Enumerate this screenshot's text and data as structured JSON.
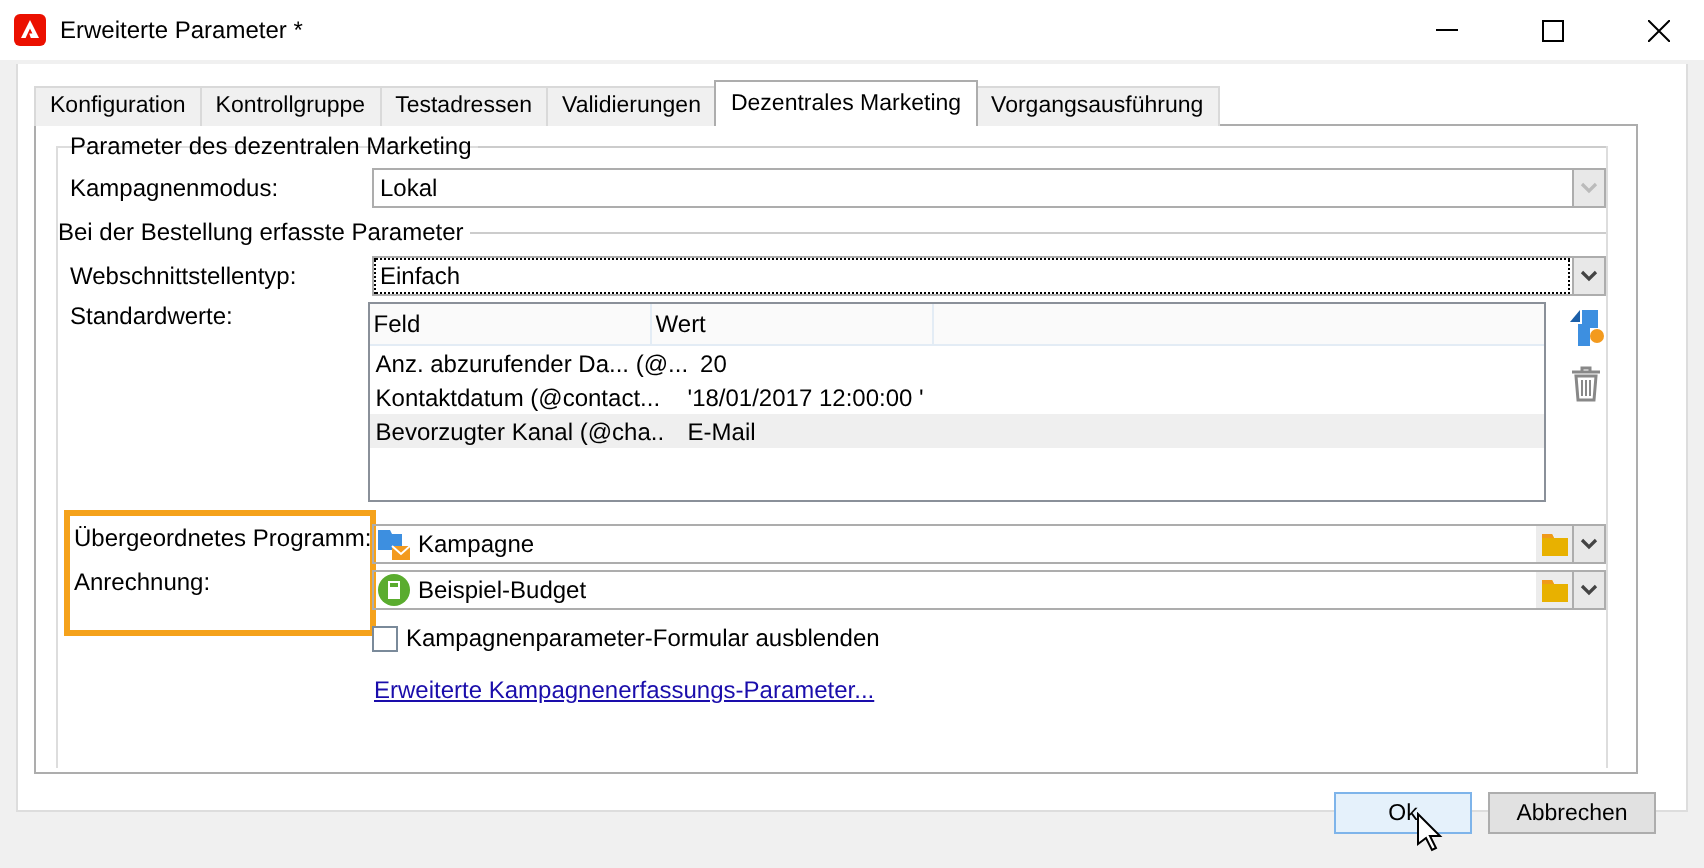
{
  "window": {
    "title": "Erweiterte Parameter *"
  },
  "tabs": [
    {
      "label": "Konfiguration",
      "selected": false
    },
    {
      "label": "Kontrollgruppe",
      "selected": false
    },
    {
      "label": "Testadressen",
      "selected": false
    },
    {
      "label": "Validierungen",
      "selected": false
    },
    {
      "label": "Dezentrales Marketing",
      "selected": true
    },
    {
      "label": "Vorgangsausführung",
      "selected": false
    }
  ],
  "group": {
    "title": "Parameter des dezentralen Marketing"
  },
  "campaign_mode": {
    "label": "Kampagnenmodus:",
    "value": "Lokal",
    "disabled": true
  },
  "section": {
    "title": "Bei der Bestellung erfasste Parameter"
  },
  "interface_type": {
    "label": "Webschnittstellentyp:",
    "value": "Einfach",
    "disabled": false
  },
  "defaults": {
    "label": "Standardwerte:",
    "columns": [
      "Feld",
      "Wert"
    ],
    "rows": [
      {
        "field": "Anz. abzurufender Da... (@...",
        "value": "20",
        "selected": false
      },
      {
        "field": "Kontaktdatum (@contact...",
        "value": "'18/01/2017 12:00:00 '",
        "selected": false
      },
      {
        "field": "Bevorzugter Kanal (@cha..",
        "value": "E-Mail",
        "selected": true
      }
    ]
  },
  "parent_program": {
    "label": "Übergeordnetes Programm:",
    "value": "Kampagne"
  },
  "charging": {
    "label": "Anrechnung:",
    "value": "Beispiel-Budget"
  },
  "hide_form": {
    "label": "Kampagnenparameter-Formular ausblenden",
    "checked": false
  },
  "link": "Erweiterte Kampagnenerfassungs-Parameter...",
  "buttons": [
    {
      "label": "Ok",
      "kind": "default"
    },
    {
      "label": "Abbrechen",
      "kind": "normal"
    }
  ]
}
